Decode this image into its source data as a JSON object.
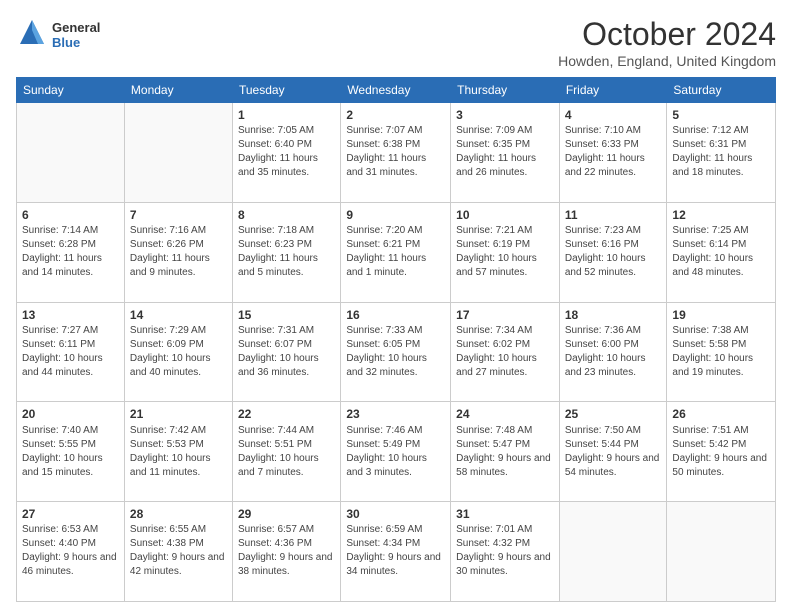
{
  "logo": {
    "general": "General",
    "blue": "Blue"
  },
  "header": {
    "month": "October 2024",
    "location": "Howden, England, United Kingdom"
  },
  "weekdays": [
    "Sunday",
    "Monday",
    "Tuesday",
    "Wednesday",
    "Thursday",
    "Friday",
    "Saturday"
  ],
  "weeks": [
    [
      {
        "day": "",
        "sunrise": "",
        "sunset": "",
        "daylight": ""
      },
      {
        "day": "",
        "sunrise": "",
        "sunset": "",
        "daylight": ""
      },
      {
        "day": "1",
        "sunrise": "Sunrise: 7:05 AM",
        "sunset": "Sunset: 6:40 PM",
        "daylight": "Daylight: 11 hours and 35 minutes."
      },
      {
        "day": "2",
        "sunrise": "Sunrise: 7:07 AM",
        "sunset": "Sunset: 6:38 PM",
        "daylight": "Daylight: 11 hours and 31 minutes."
      },
      {
        "day": "3",
        "sunrise": "Sunrise: 7:09 AM",
        "sunset": "Sunset: 6:35 PM",
        "daylight": "Daylight: 11 hours and 26 minutes."
      },
      {
        "day": "4",
        "sunrise": "Sunrise: 7:10 AM",
        "sunset": "Sunset: 6:33 PM",
        "daylight": "Daylight: 11 hours and 22 minutes."
      },
      {
        "day": "5",
        "sunrise": "Sunrise: 7:12 AM",
        "sunset": "Sunset: 6:31 PM",
        "daylight": "Daylight: 11 hours and 18 minutes."
      }
    ],
    [
      {
        "day": "6",
        "sunrise": "Sunrise: 7:14 AM",
        "sunset": "Sunset: 6:28 PM",
        "daylight": "Daylight: 11 hours and 14 minutes."
      },
      {
        "day": "7",
        "sunrise": "Sunrise: 7:16 AM",
        "sunset": "Sunset: 6:26 PM",
        "daylight": "Daylight: 11 hours and 9 minutes."
      },
      {
        "day": "8",
        "sunrise": "Sunrise: 7:18 AM",
        "sunset": "Sunset: 6:23 PM",
        "daylight": "Daylight: 11 hours and 5 minutes."
      },
      {
        "day": "9",
        "sunrise": "Sunrise: 7:20 AM",
        "sunset": "Sunset: 6:21 PM",
        "daylight": "Daylight: 11 hours and 1 minute."
      },
      {
        "day": "10",
        "sunrise": "Sunrise: 7:21 AM",
        "sunset": "Sunset: 6:19 PM",
        "daylight": "Daylight: 10 hours and 57 minutes."
      },
      {
        "day": "11",
        "sunrise": "Sunrise: 7:23 AM",
        "sunset": "Sunset: 6:16 PM",
        "daylight": "Daylight: 10 hours and 52 minutes."
      },
      {
        "day": "12",
        "sunrise": "Sunrise: 7:25 AM",
        "sunset": "Sunset: 6:14 PM",
        "daylight": "Daylight: 10 hours and 48 minutes."
      }
    ],
    [
      {
        "day": "13",
        "sunrise": "Sunrise: 7:27 AM",
        "sunset": "Sunset: 6:11 PM",
        "daylight": "Daylight: 10 hours and 44 minutes."
      },
      {
        "day": "14",
        "sunrise": "Sunrise: 7:29 AM",
        "sunset": "Sunset: 6:09 PM",
        "daylight": "Daylight: 10 hours and 40 minutes."
      },
      {
        "day": "15",
        "sunrise": "Sunrise: 7:31 AM",
        "sunset": "Sunset: 6:07 PM",
        "daylight": "Daylight: 10 hours and 36 minutes."
      },
      {
        "day": "16",
        "sunrise": "Sunrise: 7:33 AM",
        "sunset": "Sunset: 6:05 PM",
        "daylight": "Daylight: 10 hours and 32 minutes."
      },
      {
        "day": "17",
        "sunrise": "Sunrise: 7:34 AM",
        "sunset": "Sunset: 6:02 PM",
        "daylight": "Daylight: 10 hours and 27 minutes."
      },
      {
        "day": "18",
        "sunrise": "Sunrise: 7:36 AM",
        "sunset": "Sunset: 6:00 PM",
        "daylight": "Daylight: 10 hours and 23 minutes."
      },
      {
        "day": "19",
        "sunrise": "Sunrise: 7:38 AM",
        "sunset": "Sunset: 5:58 PM",
        "daylight": "Daylight: 10 hours and 19 minutes."
      }
    ],
    [
      {
        "day": "20",
        "sunrise": "Sunrise: 7:40 AM",
        "sunset": "Sunset: 5:55 PM",
        "daylight": "Daylight: 10 hours and 15 minutes."
      },
      {
        "day": "21",
        "sunrise": "Sunrise: 7:42 AM",
        "sunset": "Sunset: 5:53 PM",
        "daylight": "Daylight: 10 hours and 11 minutes."
      },
      {
        "day": "22",
        "sunrise": "Sunrise: 7:44 AM",
        "sunset": "Sunset: 5:51 PM",
        "daylight": "Daylight: 10 hours and 7 minutes."
      },
      {
        "day": "23",
        "sunrise": "Sunrise: 7:46 AM",
        "sunset": "Sunset: 5:49 PM",
        "daylight": "Daylight: 10 hours and 3 minutes."
      },
      {
        "day": "24",
        "sunrise": "Sunrise: 7:48 AM",
        "sunset": "Sunset: 5:47 PM",
        "daylight": "Daylight: 9 hours and 58 minutes."
      },
      {
        "day": "25",
        "sunrise": "Sunrise: 7:50 AM",
        "sunset": "Sunset: 5:44 PM",
        "daylight": "Daylight: 9 hours and 54 minutes."
      },
      {
        "day": "26",
        "sunrise": "Sunrise: 7:51 AM",
        "sunset": "Sunset: 5:42 PM",
        "daylight": "Daylight: 9 hours and 50 minutes."
      }
    ],
    [
      {
        "day": "27",
        "sunrise": "Sunrise: 6:53 AM",
        "sunset": "Sunset: 4:40 PM",
        "daylight": "Daylight: 9 hours and 46 minutes."
      },
      {
        "day": "28",
        "sunrise": "Sunrise: 6:55 AM",
        "sunset": "Sunset: 4:38 PM",
        "daylight": "Daylight: 9 hours and 42 minutes."
      },
      {
        "day": "29",
        "sunrise": "Sunrise: 6:57 AM",
        "sunset": "Sunset: 4:36 PM",
        "daylight": "Daylight: 9 hours and 38 minutes."
      },
      {
        "day": "30",
        "sunrise": "Sunrise: 6:59 AM",
        "sunset": "Sunset: 4:34 PM",
        "daylight": "Daylight: 9 hours and 34 minutes."
      },
      {
        "day": "31",
        "sunrise": "Sunrise: 7:01 AM",
        "sunset": "Sunset: 4:32 PM",
        "daylight": "Daylight: 9 hours and 30 minutes."
      },
      {
        "day": "",
        "sunrise": "",
        "sunset": "",
        "daylight": ""
      },
      {
        "day": "",
        "sunrise": "",
        "sunset": "",
        "daylight": ""
      }
    ]
  ]
}
